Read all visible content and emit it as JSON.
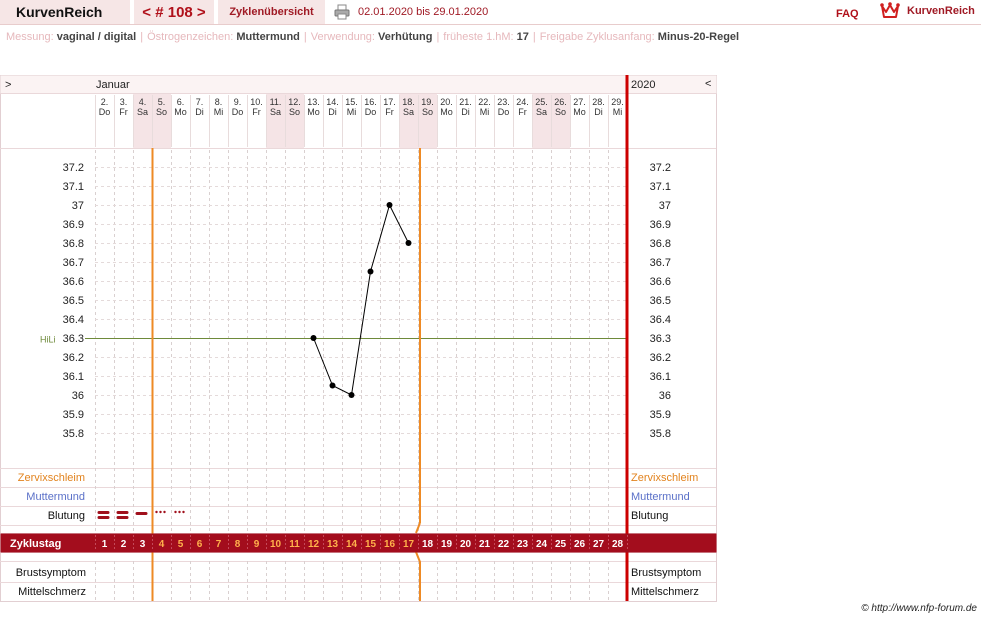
{
  "header": {
    "brand": "KurvenReich",
    "cycle_label": "< # 108 >",
    "overview_label": "Zyklenübersicht",
    "date_range": "02.01.2020 bis 29.01.2020",
    "faq": "FAQ",
    "logo_text": "KurvenReich"
  },
  "meta": [
    {
      "key": "Messung:",
      "value": "vaginal / digital"
    },
    {
      "key": "Östrogenzeichen:",
      "value": "Muttermund"
    },
    {
      "key": "Verwendung:",
      "value": "Verhütung"
    },
    {
      "key": "früheste 1.hM:",
      "value": "17"
    },
    {
      "key": "Freigabe Zyklusanfang:",
      "value": "Minus-20-Regel"
    }
  ],
  "chart_data": {
    "type": "line",
    "month": "Januar",
    "year": "2020",
    "nav_left": ">",
    "nav_right": "<",
    "days": [
      {
        "d": "2.",
        "w": "Do"
      },
      {
        "d": "3.",
        "w": "Fr"
      },
      {
        "d": "4.",
        "w": "Sa"
      },
      {
        "d": "5.",
        "w": "So"
      },
      {
        "d": "6.",
        "w": "Mo"
      },
      {
        "d": "7.",
        "w": "Di"
      },
      {
        "d": "8.",
        "w": "Mi"
      },
      {
        "d": "9.",
        "w": "Do"
      },
      {
        "d": "10.",
        "w": "Fr"
      },
      {
        "d": "11.",
        "w": "Sa"
      },
      {
        "d": "12.",
        "w": "So"
      },
      {
        "d": "13.",
        "w": "Mo"
      },
      {
        "d": "14.",
        "w": "Di"
      },
      {
        "d": "15.",
        "w": "Mi"
      },
      {
        "d": "16.",
        "w": "Do"
      },
      {
        "d": "17.",
        "w": "Fr"
      },
      {
        "d": "18.",
        "w": "Sa"
      },
      {
        "d": "19.",
        "w": "So"
      },
      {
        "d": "20.",
        "w": "Mo"
      },
      {
        "d": "21.",
        "w": "Di"
      },
      {
        "d": "22.",
        "w": "Mi"
      },
      {
        "d": "23.",
        "w": "Do"
      },
      {
        "d": "24.",
        "w": "Fr"
      },
      {
        "d": "25.",
        "w": "Sa"
      },
      {
        "d": "26.",
        "w": "So"
      },
      {
        "d": "27.",
        "w": "Mo"
      },
      {
        "d": "28.",
        "w": "Di"
      },
      {
        "d": "29.",
        "w": "Mi"
      }
    ],
    "y_ticks": [
      "37.2",
      "37.1",
      "37",
      "36.9",
      "36.8",
      "36.7",
      "36.6",
      "36.5",
      "36.4",
      "36.3",
      "36.2",
      "36.1",
      "36",
      "35.9",
      "35.8"
    ],
    "ylim": [
      35.8,
      37.2
    ],
    "coverline": {
      "label": "HiLi",
      "value": 36.3
    },
    "temperatures": [
      {
        "cycle_day": 12,
        "value": 36.3
      },
      {
        "cycle_day": 13,
        "value": 36.05
      },
      {
        "cycle_day": 14,
        "value": 36.0
      },
      {
        "cycle_day": 15,
        "value": 36.65
      },
      {
        "cycle_day": 16,
        "value": 37.0
      },
      {
        "cycle_day": 17,
        "value": 36.8
      }
    ],
    "markers": {
      "after_cycle_day": 3,
      "second_after_cycle_day": 17
    },
    "rows_top": [
      "Zervixschleim",
      "Muttermund",
      "Blutung"
    ],
    "rows_bottom": [
      "Brustsymptom",
      "Mittelschmerz"
    ],
    "zyklustag_label": "Zyklustag",
    "cycle_days": [
      "1",
      "2",
      "3",
      "4",
      "5",
      "6",
      "7",
      "8",
      "9",
      "10",
      "11",
      "12",
      "13",
      "14",
      "15",
      "16",
      "17",
      "18",
      "19",
      "20",
      "21",
      "22",
      "23",
      "24",
      "25",
      "26",
      "27",
      "28"
    ],
    "bleeding": [
      {
        "cycle_day": 1,
        "level": "heavy"
      },
      {
        "cycle_day": 2,
        "level": "heavy"
      },
      {
        "cycle_day": 3,
        "level": "medium"
      },
      {
        "cycle_day": 4,
        "level": "spotting"
      },
      {
        "cycle_day": 5,
        "level": "spotting"
      }
    ],
    "colors": {
      "accent": "#a0101c",
      "orange": "#ee8a24",
      "red_line": "#cc0000",
      "coverline": "#6e8a3a",
      "cervical": "#e2831e",
      "cervix": "#5a70c8",
      "weekend": "#f5e4e6",
      "cycle_bar": "#a30d1d",
      "cycle_highlight": "#ffb24c"
    }
  },
  "footer": {
    "copyright": "© http://www.nfp-forum.de"
  }
}
